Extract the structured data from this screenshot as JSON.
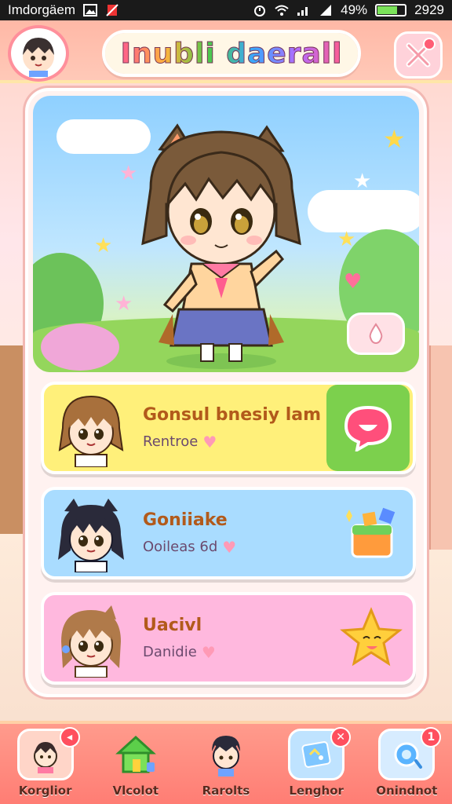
{
  "status_bar": {
    "carrier": "Imdorgäem",
    "battery_percent": "49%",
    "time": "2929"
  },
  "header": {
    "title": "Inubli daerall"
  },
  "cards": [
    {
      "name": "Gonsul bnesiy lam",
      "subtitle": "Rentroe",
      "accent": "#fff07a",
      "action_icon": "chat-bubble-icon"
    },
    {
      "name": "Goniiake",
      "subtitle": "Ooileas 6d",
      "accent": "#a9dcff",
      "action_icon": "gift-box-icon"
    },
    {
      "name": "Uacivl",
      "subtitle": "Danidie",
      "accent": "#ffb8de",
      "action_icon": "star-friend-icon"
    }
  ],
  "bottom_nav": [
    {
      "label": "Korglior",
      "icon": "character-icon",
      "badge": ""
    },
    {
      "label": "Vlcolot",
      "icon": "house-icon",
      "badge": ""
    },
    {
      "label": "Rarolts",
      "icon": "face-icon",
      "badge": ""
    },
    {
      "label": "Lenghor",
      "icon": "card-icon",
      "badge": ""
    },
    {
      "label": "Onindnot",
      "icon": "orb-icon",
      "badge": "1"
    }
  ],
  "colors": {
    "header": "#ffb8a6",
    "panel_border": "#f2b8b3",
    "nav": "#ff7d74"
  }
}
